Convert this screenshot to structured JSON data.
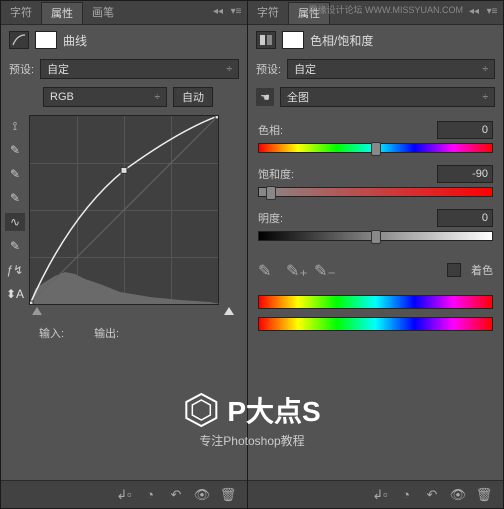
{
  "left": {
    "tabs": [
      "字符",
      "属性",
      "画笔"
    ],
    "active_tab": 1,
    "title": "曲线",
    "preset_label": "预设:",
    "preset_value": "自定",
    "channel": "RGB",
    "auto": "自动",
    "input_label": "输入:",
    "output_label": "输出:"
  },
  "right": {
    "tabs": [
      "字符",
      "属性"
    ],
    "active_tab": 1,
    "title": "色相/饱和度",
    "preset_label": "预设:",
    "preset_value": "自定",
    "range": "全图",
    "sliders": {
      "hue": {
        "label": "色相:",
        "value": "0",
        "pos": 50
      },
      "sat": {
        "label": "饱和度:",
        "value": "-90",
        "pos": 5
      },
      "light": {
        "label": "明度:",
        "value": "0",
        "pos": 50
      }
    },
    "colorize": "着色"
  },
  "watermark": {
    "title": "P大点S",
    "sub": "专注Photoshop教程",
    "top": "思缘设计论坛  WWW.MISSYUAN.COM"
  },
  "chart_data": {
    "type": "line",
    "title": "曲线",
    "xlabel": "输入",
    "ylabel": "输出",
    "xlim": [
      0,
      255
    ],
    "ylim": [
      0,
      255
    ],
    "series": [
      {
        "name": "RGB",
        "points": [
          [
            0,
            0
          ],
          [
            64,
            110
          ],
          [
            128,
            180
          ],
          [
            192,
            230
          ],
          [
            255,
            255
          ]
        ]
      }
    ]
  }
}
